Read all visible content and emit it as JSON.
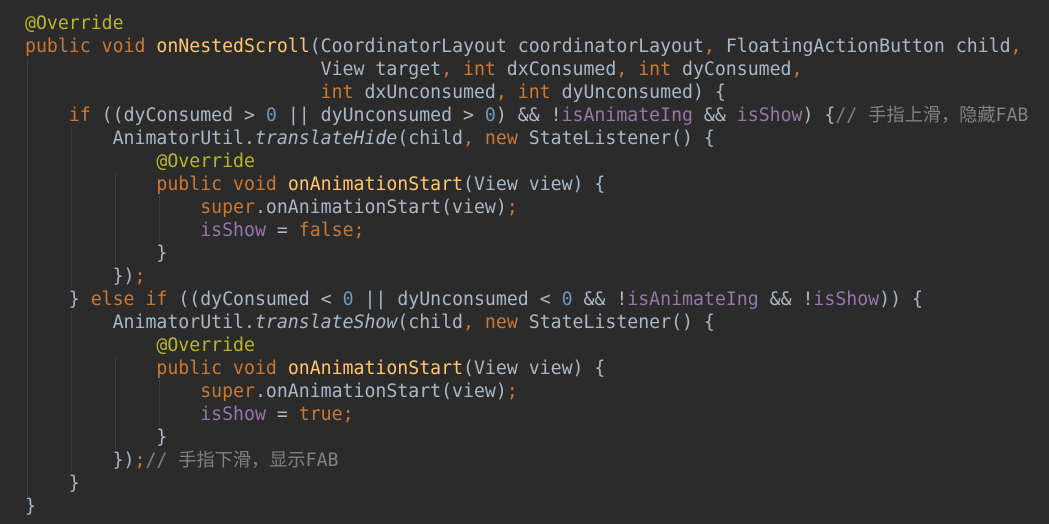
{
  "editor": {
    "theme": {
      "background": "#2b2b2b",
      "text": "#a9b7c6",
      "keyword": "#cc7832",
      "annotation": "#bbb529",
      "method": "#ffc66d",
      "number": "#6897bb",
      "field": "#9876aa",
      "comment": "#808080"
    },
    "lines": [
      [
        [
          "a",
          "@Override"
        ]
      ],
      [
        [
          "k",
          "public void "
        ],
        [
          "m",
          "onNestedScroll"
        ],
        [
          "p",
          "(CoordinatorLayout coordinatorLayout"
        ],
        [
          "k",
          ", "
        ],
        [
          "p",
          "FloatingActionButton child"
        ],
        [
          "k",
          ","
        ]
      ],
      [
        [
          "p",
          "                           View target"
        ],
        [
          "k",
          ", int "
        ],
        [
          "p",
          "dxConsumed"
        ],
        [
          "k",
          ", int "
        ],
        [
          "p",
          "dyConsumed"
        ],
        [
          "k",
          ","
        ]
      ],
      [
        [
          "p",
          "                           "
        ],
        [
          "k",
          "int "
        ],
        [
          "p",
          "dxUnconsumed"
        ],
        [
          "k",
          ", int "
        ],
        [
          "p",
          "dyUnconsumed) {"
        ]
      ],
      [
        [
          "p",
          "    "
        ],
        [
          "k",
          "if "
        ],
        [
          "p",
          "((dyConsumed > "
        ],
        [
          "n",
          "0"
        ],
        [
          "p",
          " || dyUnconsumed > "
        ],
        [
          "n",
          "0"
        ],
        [
          "p",
          ") && !"
        ],
        [
          "f",
          "isAnimateIng"
        ],
        [
          "p",
          " && "
        ],
        [
          "f",
          "isShow"
        ],
        [
          "p",
          ") {"
        ],
        [
          "c",
          "// 手指上滑，隐藏FAB"
        ]
      ],
      [
        [
          "p",
          "        AnimatorUtil."
        ],
        [
          "i",
          "translateHide"
        ],
        [
          "p",
          "(child"
        ],
        [
          "k",
          ", new "
        ],
        [
          "p",
          "StateListener() {"
        ]
      ],
      [
        [
          "p",
          "            "
        ],
        [
          "a",
          "@Override"
        ]
      ],
      [
        [
          "p",
          "            "
        ],
        [
          "k",
          "public void "
        ],
        [
          "m",
          "onAnimationStart"
        ],
        [
          "p",
          "(View view) {"
        ]
      ],
      [
        [
          "p",
          "                "
        ],
        [
          "k",
          "super"
        ],
        [
          "p",
          ".onAnimationStart(view)"
        ],
        [
          "k",
          ";"
        ]
      ],
      [
        [
          "p",
          "                "
        ],
        [
          "f",
          "isShow"
        ],
        [
          "p",
          " = "
        ],
        [
          "k",
          "false;"
        ]
      ],
      [
        [
          "p",
          "            }"
        ]
      ],
      [
        [
          "p",
          "        })"
        ],
        [
          "k",
          ";"
        ]
      ],
      [
        [
          "p",
          "    } "
        ],
        [
          "k",
          "else if "
        ],
        [
          "p",
          "((dyConsumed < "
        ],
        [
          "n",
          "0"
        ],
        [
          "p",
          " || dyUnconsumed < "
        ],
        [
          "n",
          "0"
        ],
        [
          "p",
          " && !"
        ],
        [
          "f",
          "isAnimateIng"
        ],
        [
          "p",
          " && !"
        ],
        [
          "f",
          "isShow"
        ],
        [
          "p",
          ")) {"
        ]
      ],
      [
        [
          "p",
          "        AnimatorUtil."
        ],
        [
          "i",
          "translateShow"
        ],
        [
          "p",
          "(child"
        ],
        [
          "k",
          ", new "
        ],
        [
          "p",
          "StateListener() {"
        ]
      ],
      [
        [
          "p",
          "            "
        ],
        [
          "a",
          "@Override"
        ]
      ],
      [
        [
          "p",
          "            "
        ],
        [
          "k",
          "public void "
        ],
        [
          "m",
          "onAnimationStart"
        ],
        [
          "p",
          "(View view) {"
        ]
      ],
      [
        [
          "p",
          "                "
        ],
        [
          "k",
          "super"
        ],
        [
          "p",
          ".onAnimationStart(view)"
        ],
        [
          "k",
          ";"
        ]
      ],
      [
        [
          "p",
          "                "
        ],
        [
          "f",
          "isShow"
        ],
        [
          "p",
          " = "
        ],
        [
          "k",
          "true;"
        ]
      ],
      [
        [
          "p",
          "            }"
        ]
      ],
      [
        [
          "p",
          "        })"
        ],
        [
          "k",
          ";"
        ],
        [
          "c",
          "// 手指下滑，显示FAB"
        ]
      ],
      [
        [
          "p",
          "    }"
        ]
      ],
      [
        [
          "p",
          "}"
        ]
      ]
    ]
  }
}
